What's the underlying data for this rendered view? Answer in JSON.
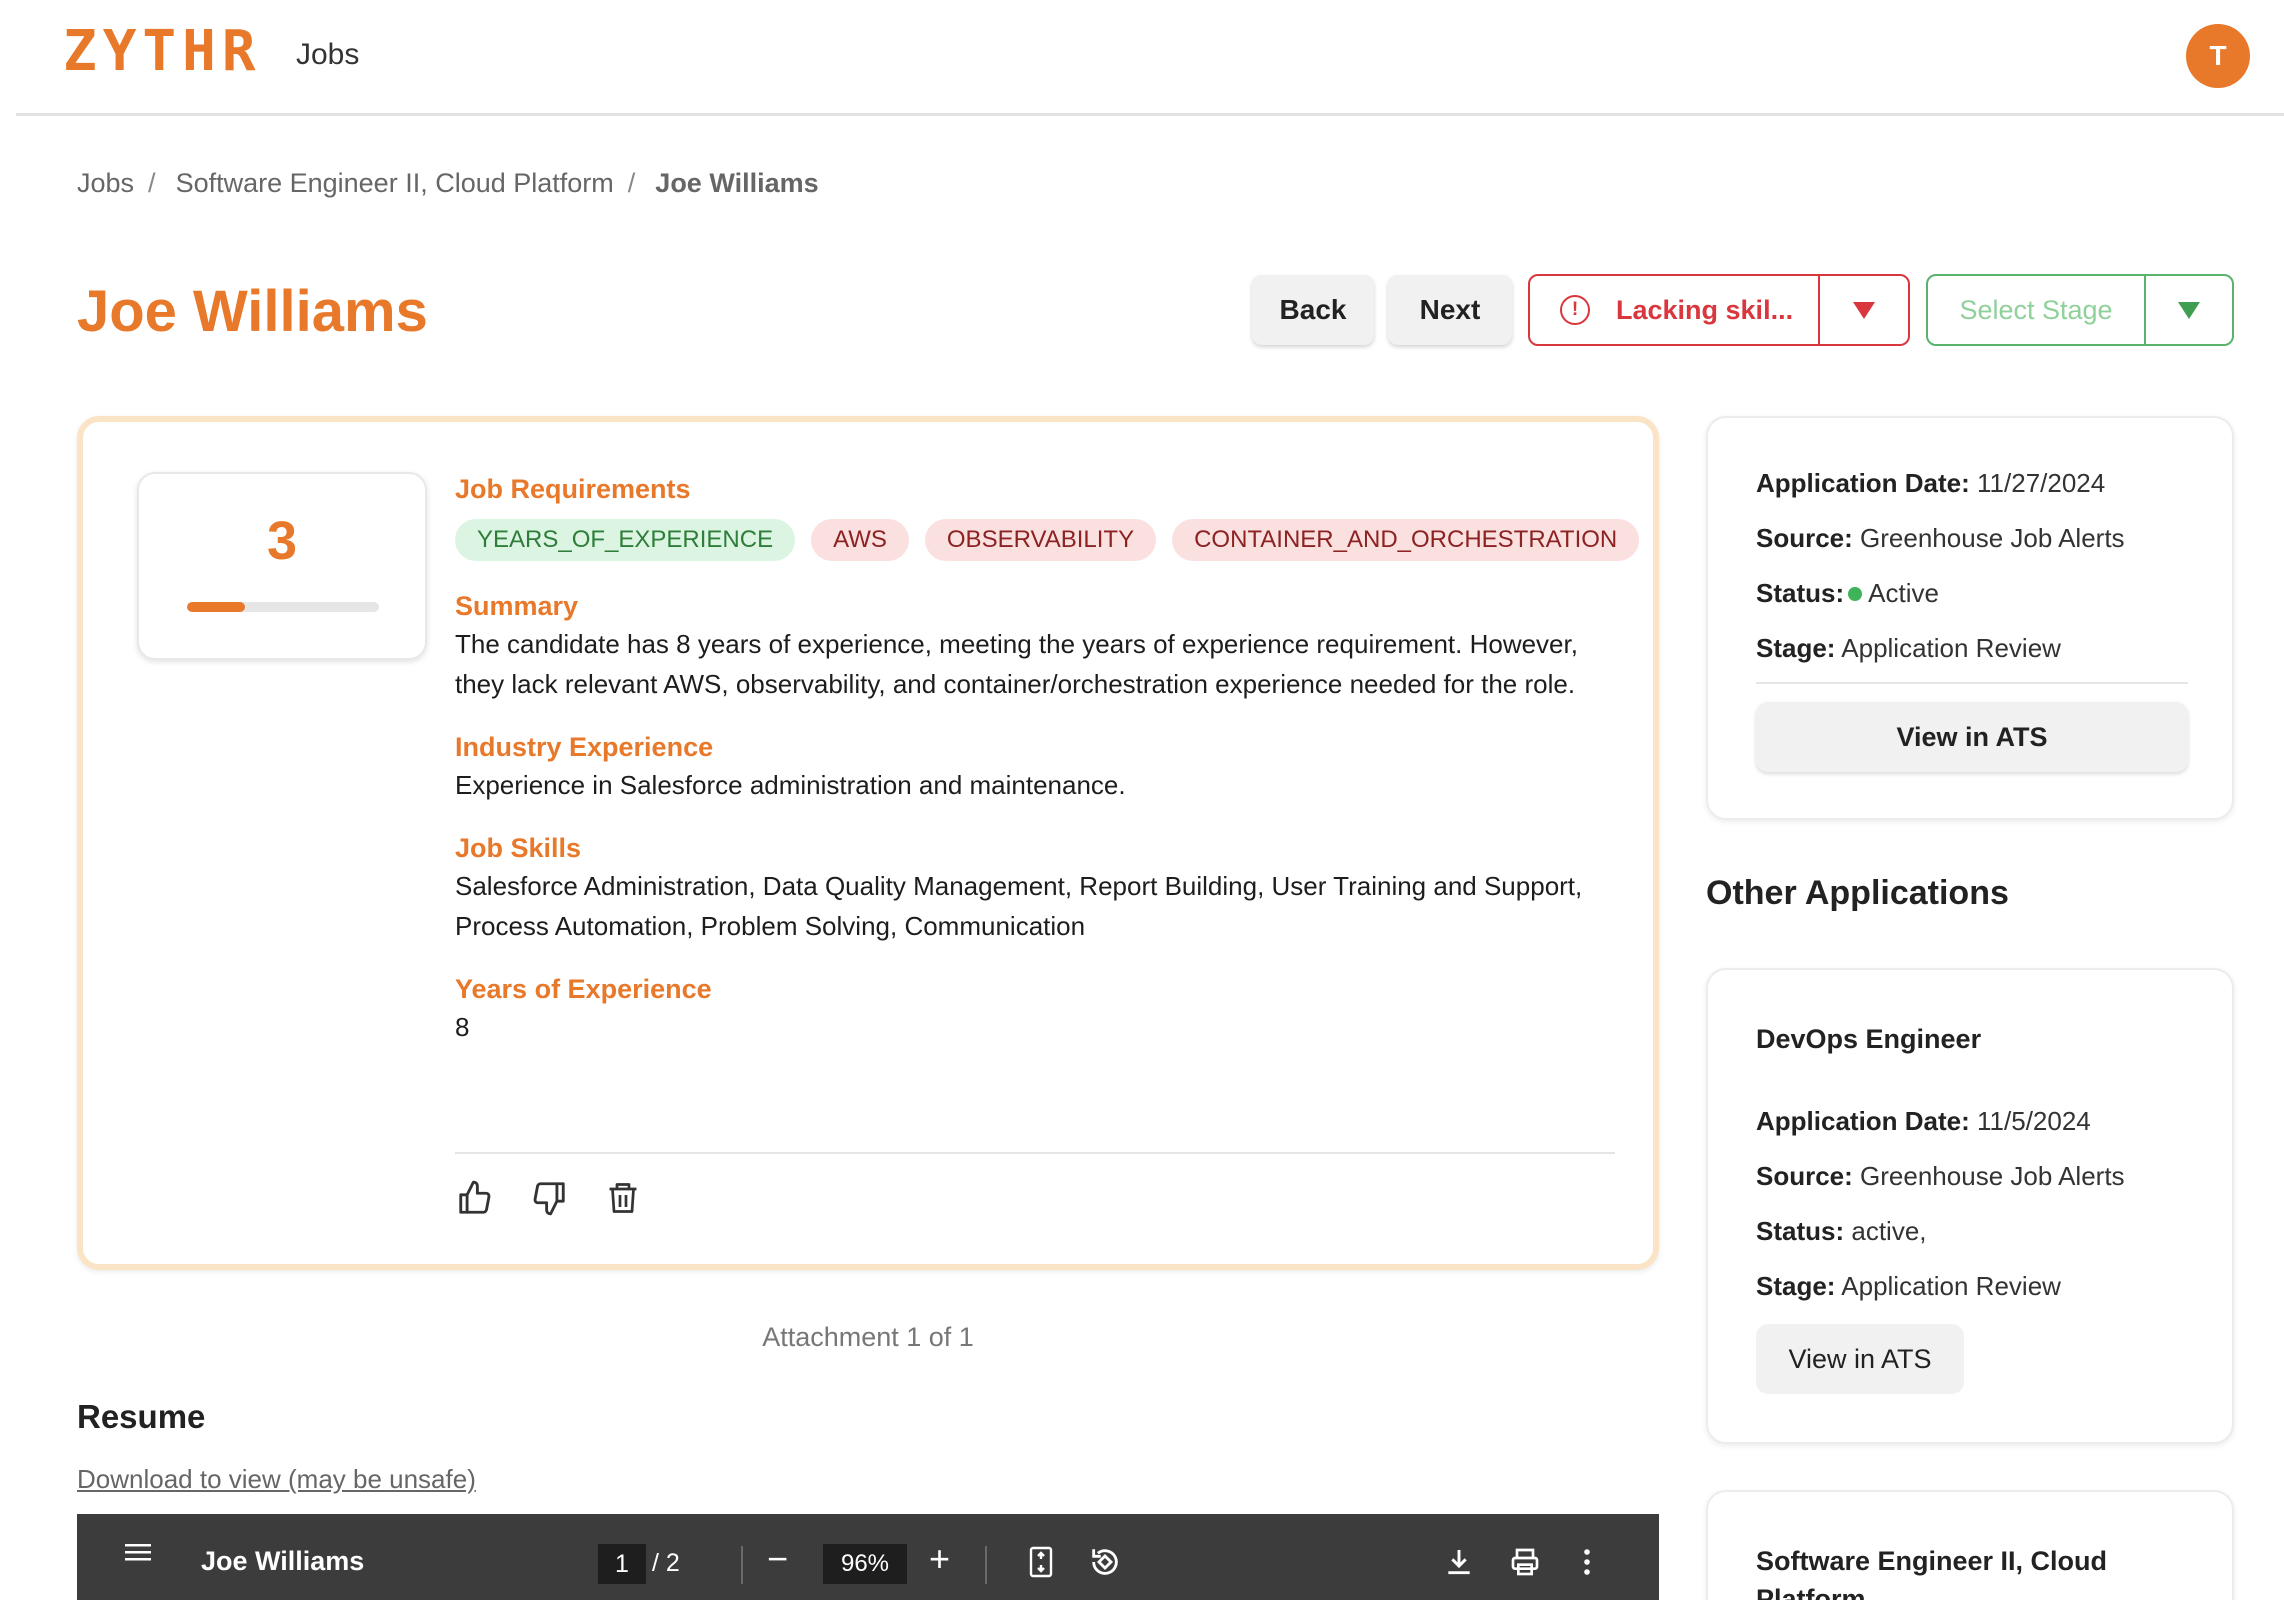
{
  "header": {
    "logo_text": "ZYTHR",
    "nav_jobs": "Jobs",
    "avatar_initial": "T"
  },
  "breadcrumb": {
    "items": [
      "Jobs",
      "Software Engineer II, Cloud Platform",
      "Joe Williams"
    ],
    "separator": "/"
  },
  "candidate": {
    "name": "Joe Williams"
  },
  "actions": {
    "back": "Back",
    "next": "Next",
    "issue_label": "Lacking skil...",
    "issue_icon": "!",
    "stage_placeholder": "Select Stage"
  },
  "evaluation": {
    "score": "3",
    "score_fraction": 0.3,
    "job_requirements_label": "Job Requirements",
    "requirements": [
      {
        "label": "YEARS_OF_EXPERIENCE",
        "met": true
      },
      {
        "label": "AWS",
        "met": false
      },
      {
        "label": "OBSERVABILITY",
        "met": false
      },
      {
        "label": "CONTAINER_AND_ORCHESTRATION",
        "met": false
      }
    ],
    "summary_label": "Summary",
    "summary_text": "The candidate has 8 years of experience, meeting the years of experience requirement. However, they lack relevant AWS, observability, and container/orchestration experience needed for the role.",
    "industry_label": "Industry Experience",
    "industry_text": "Experience in Salesforce administration and maintenance.",
    "skills_label": "Job Skills",
    "skills_text": "Salesforce Administration, Data Quality Management, Report Building, User Training and Support, Process Automation, Problem Solving, Communication",
    "years_label": "Years of Experience",
    "years_value": "8"
  },
  "attachments": {
    "counter": "Attachment 1 of 1",
    "resume_title": "Resume",
    "download_link": "Download to view (may be unsafe)"
  },
  "pdf_viewer": {
    "file_name": "Joe Williams",
    "current_page": "1",
    "total_pages": "/ 2",
    "zoom": "96%",
    "minus": "−",
    "plus": "+"
  },
  "application_info": {
    "date_label": "Application Date:",
    "date_value": "11/27/2024",
    "source_label": "Source:",
    "source_value": "Greenhouse Job Alerts",
    "status_label": "Status:",
    "status_value": "Active",
    "stage_label": "Stage:",
    "stage_value": "Application Review",
    "ats_button": "View in ATS",
    "status_color": "#3fb35a"
  },
  "other_applications": {
    "title": "Other Applications",
    "items": [
      {
        "job_title": "DevOps Engineer",
        "date_label": "Application Date:",
        "date_value": "11/5/2024",
        "source_label": "Source:",
        "source_value": "Greenhouse Job Alerts",
        "status_label": "Status:",
        "status_value": "active,",
        "stage_label": "Stage:",
        "stage_value": "Application Review",
        "ats_button": "View in ATS"
      },
      {
        "job_title": "Software Engineer II, Cloud Platform"
      }
    ]
  },
  "colors": {
    "brand": "#e8782a",
    "danger": "#d9363e",
    "success": "#59b36a"
  }
}
